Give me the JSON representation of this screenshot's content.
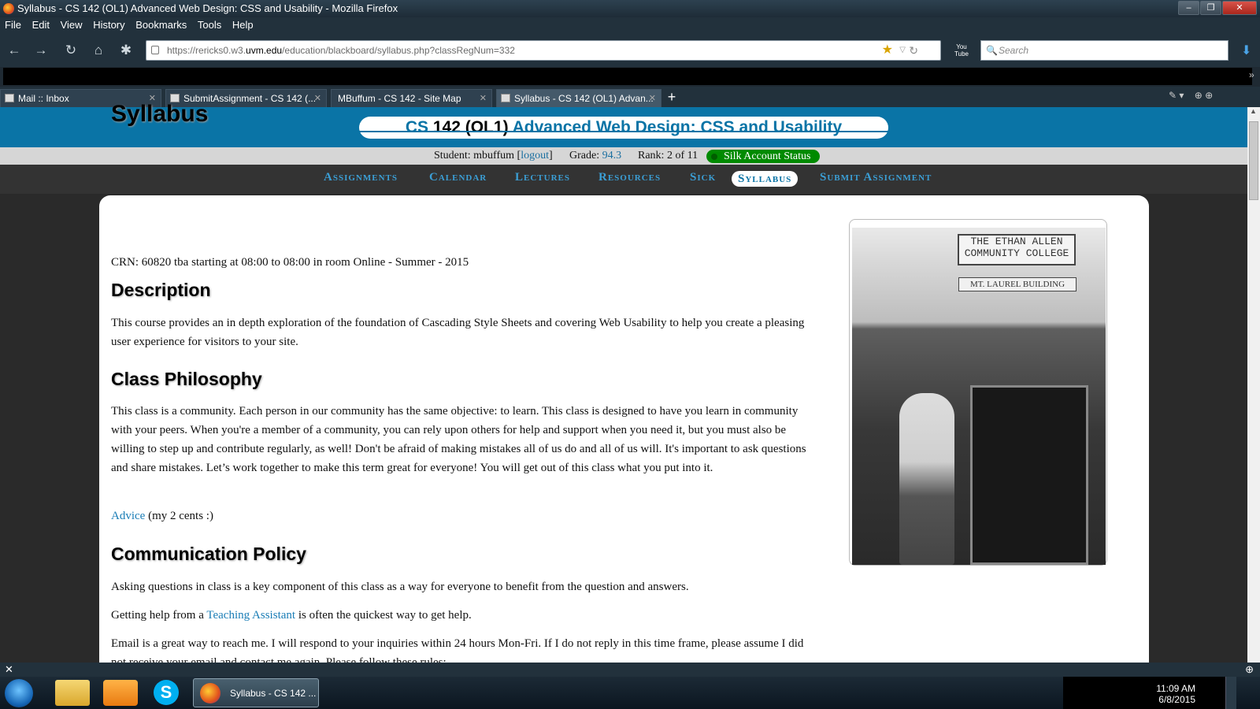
{
  "window": {
    "title": "Syllabus - CS 142 (OL1) Advanced Web Design: CSS and Usability - Mozilla Firefox"
  },
  "menu": [
    "File",
    "Edit",
    "View",
    "History",
    "Bookmarks",
    "Tools",
    "Help"
  ],
  "urlbar": {
    "prefix": "https://rericks0.w3.",
    "domain": "uvm.edu",
    "suffix": "/education/blackboard/syllabus.php?classRegNum=332"
  },
  "search": {
    "placeholder": "Search"
  },
  "tabs": [
    {
      "label": "Mail :: Inbox"
    },
    {
      "label": "SubmitAssignment - CS 142 (..."
    },
    {
      "label": "MBuffum - CS 142 - Site Map"
    },
    {
      "label": "Syllabus - CS 142 (OL1) Advan..."
    }
  ],
  "site": {
    "course_code": "CS",
    "course_num": "142 (OL1)",
    "course_title": "Advanced Web Design: CSS and Usability",
    "student_label": "Student: mbuffum [",
    "logout": "logout",
    "student_close": "]",
    "grade_label": "Grade:",
    "grade": "94.3",
    "rank": "Rank: 2 of 11",
    "silk": "Silk Account Status"
  },
  "nav": [
    "Assignments",
    "Calendar",
    "Lectures",
    "Resources",
    "Sick",
    "Syllabus",
    "Submit Assignment"
  ],
  "page": {
    "title": "Syllabus",
    "crn": "CRN: 60820 tba starting at 08:00 to 08:00 in room Online - Summer - 2015",
    "h_description": "Description",
    "description": "This course provides an in depth exploration of the foundation of Cascading Style Sheets and covering Web Usability to help you create a pleasing user experience for visitors to your site.",
    "h_philosophy": "Class Philosophy",
    "philosophy": "This class is a community. Each person in our community has the same objective: to learn. This class is designed to have you learn in community with your peers. When you're a member of a community, you can rely upon others for help and support when you need it, but you must also be willing to step up and contribute regularly, as well! Don't be afraid of making mistakes all of us do and all of us will. It's important to ask questions and share mistakes. Let’s work together to make this term great for everyone! You will get out of this class what you put into it.",
    "advice_link": "Advice",
    "advice_rest": " (my 2 cents :)",
    "h_communication": "Communication Policy",
    "comm1": "Asking questions in class is a key component of this class as a way for everyone to benefit from the question and answers.",
    "comm2_pre": "Getting help from a ",
    "comm2_link": "Teaching Assistant",
    "comm2_post": " is often the quickest way to get help.",
    "comm3": "Email is a great way to reach me. I will respond to your inquiries within 24 hours Mon-Fri. If I do not reply in this time frame, please assume I did not receive your email and contact me again. Please follow these rules:",
    "photo_sign1": "THE ETHAN ALLEN COMMUNITY COLLEGE",
    "photo_sign2": "MT. LAUREL BUILDING"
  },
  "taskbar": {
    "firefox_label": "Syllabus - CS 142 ...",
    "time": "11:09 AM",
    "date": "6/8/2015"
  }
}
